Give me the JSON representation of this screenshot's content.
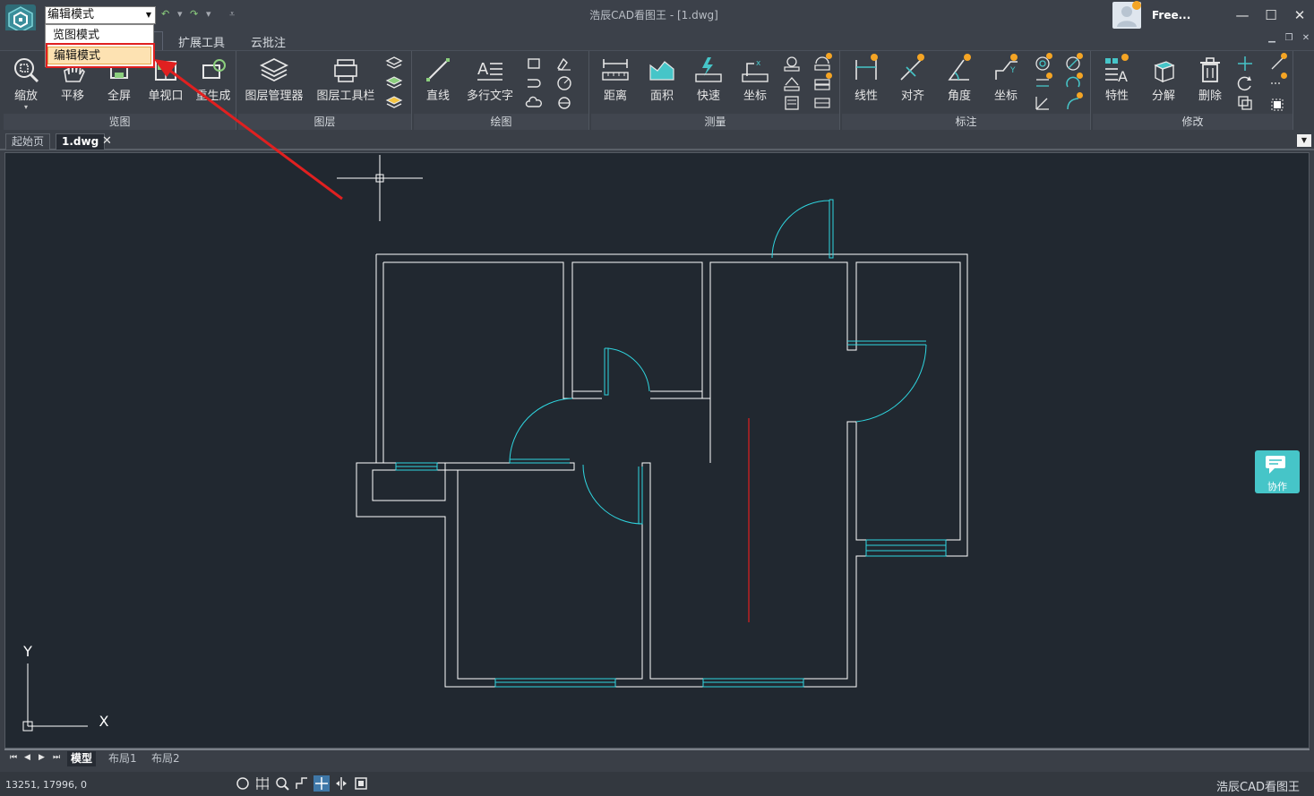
{
  "title_bar": {
    "mode_value": "编辑模式",
    "app_title": "浩辰CAD看图王 - [1.dwg]",
    "user_name": "Free...",
    "minimize": "—",
    "maximize": "☐",
    "close": "✕"
  },
  "mode_dropdown": {
    "options": [
      "览图模式",
      "编辑模式"
    ],
    "selected": "编辑模式"
  },
  "menu": {
    "tabs": [
      "扩展工具",
      "云批注"
    ]
  },
  "ribbon": {
    "panels": {
      "view": {
        "label": "览图",
        "tools": [
          "缩放",
          "平移",
          "全屏",
          "单视口",
          "重生成"
        ]
      },
      "layer": {
        "label": "图层",
        "tools": [
          "图层管理器",
          "图层工具栏"
        ]
      },
      "draw": {
        "label": "绘图",
        "tools": [
          "直线",
          "多行文字"
        ]
      },
      "measure": {
        "label": "测量",
        "tools": [
          "距离",
          "面积",
          "快速",
          "坐标"
        ]
      },
      "annotate": {
        "label": "标注",
        "tools": [
          "线性",
          "对齐",
          "角度",
          "坐标"
        ]
      },
      "modify": {
        "label": "修改",
        "tools": [
          "特性",
          "分解",
          "删除"
        ]
      }
    }
  },
  "doc_tabs": [
    "起始页",
    "1.dwg"
  ],
  "layout_tabs": [
    "模型",
    "布局1",
    "布局2"
  ],
  "status": {
    "coordinates": "13251, 17996, 0",
    "brand": "浩辰CAD看图王"
  },
  "collab": {
    "label": "协作"
  },
  "ucs": {
    "x_label": "X",
    "y_label": "Y"
  },
  "colors": {
    "canvas": "#212830",
    "wall": "#ffffff",
    "door": "#2fd6e0",
    "highlight": "#e02020",
    "accent": "#46c5c8"
  },
  "icons": {
    "logo": "gstarcad-logo",
    "undo": "undo-icon",
    "redo": "redo-icon"
  }
}
